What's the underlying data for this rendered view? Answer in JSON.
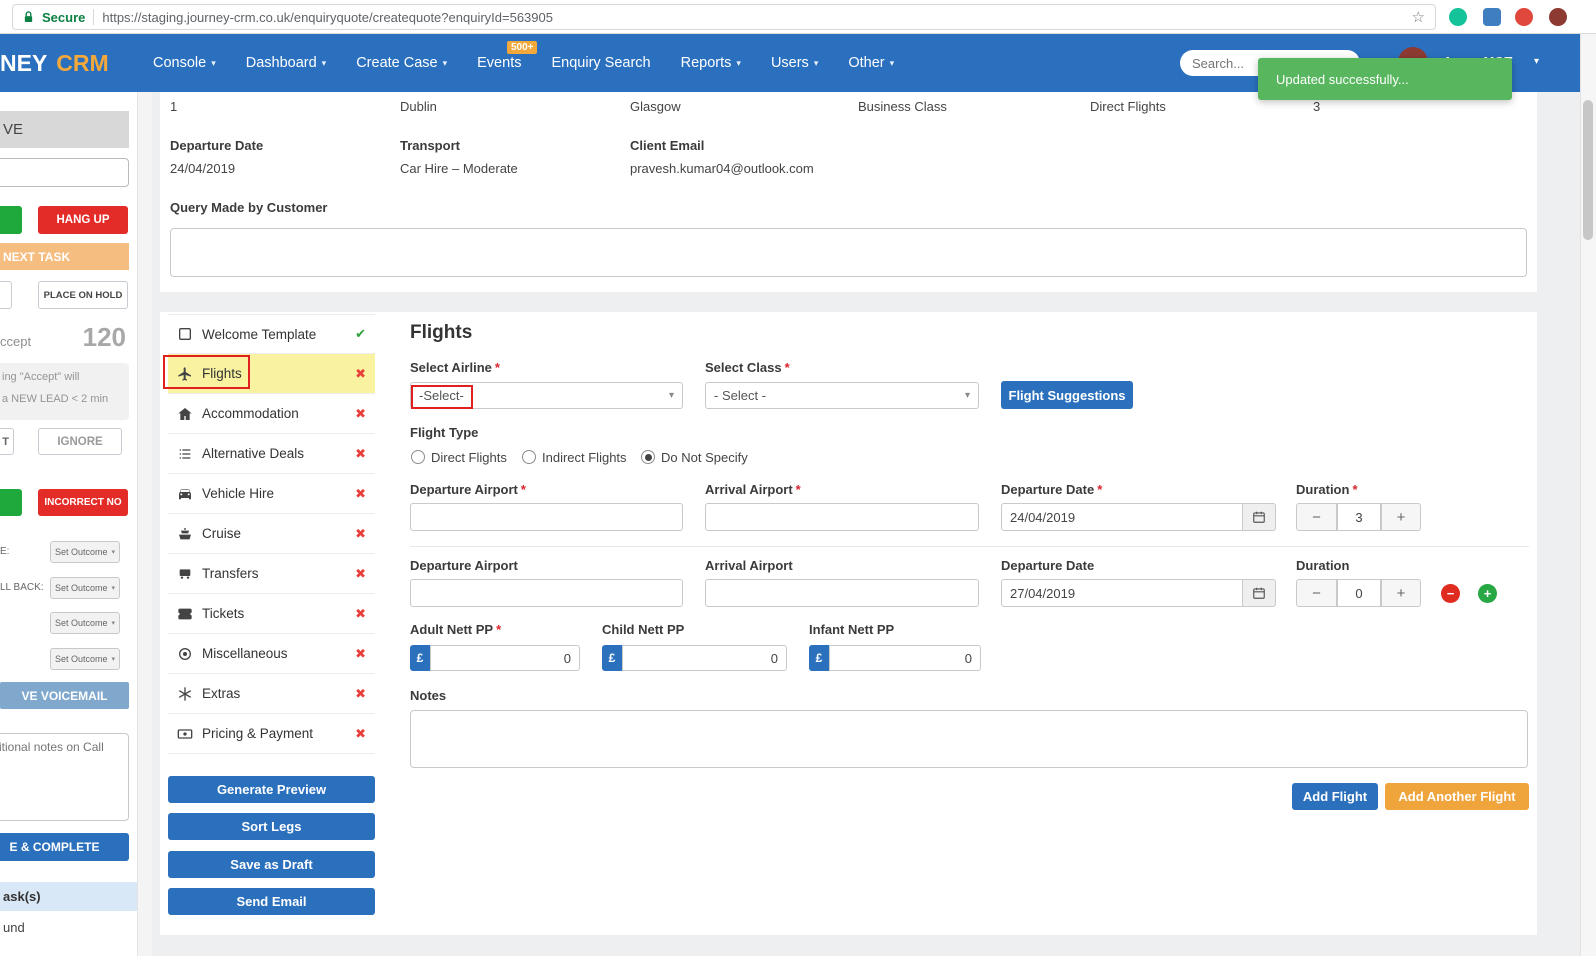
{
  "browser": {
    "secure_label": "Secure",
    "url": "https://staging.journey-crm.co.uk/enquiryquote/createquote?enquiryId=563905"
  },
  "toast": {
    "message": "Updated successfully..."
  },
  "nav": {
    "brand_left": "NEY",
    "brand_right": "CRM",
    "menu": [
      {
        "label": "Console"
      },
      {
        "label": "Dashboard"
      },
      {
        "label": "Create Case"
      },
      {
        "label": "Events",
        "badge": "500+"
      },
      {
        "label": "Enquiry Search"
      },
      {
        "label": "Reports"
      },
      {
        "label": "Users"
      },
      {
        "label": "Other"
      }
    ],
    "search_placeholder": "Search...",
    "user_name": "Arnav MQT"
  },
  "left_panel": {
    "header_fragment": "VE",
    "hang_up_button": "HANG UP",
    "next_task_label": "NEXT TASK",
    "place_on_hold_button": "PLACE ON HOLD",
    "accept_fragment": "ccept",
    "accept_count": "120",
    "accept_note_line1": "ing \"Accept\" will",
    "accept_note_line2": "a NEW LEAD < 2 min",
    "accept_button_fragment": "T",
    "ignore_button": "IGNORE",
    "incorrect_no_button": "INCORRECT NO",
    "outcome_label_1": "E:",
    "outcome_label_2": "LL BACK:",
    "outcome_value": "Set Outcome",
    "voicemail_button": "VE VOICEMAIL",
    "notes_placeholder": "itional notes on Call",
    "complete_button": "E & COMPLETE",
    "tasks_fragment": "ask(s)",
    "found_fragment": "und"
  },
  "enquiry": {
    "row_values": [
      "1",
      "Dublin",
      "Glasgow",
      "Business Class",
      "Direct Flights",
      "3"
    ],
    "fields": [
      {
        "label": "Departure Date",
        "value": "24/04/2019"
      },
      {
        "label": "Transport",
        "value": "Car Hire – Moderate"
      },
      {
        "label": "Client Email",
        "value": "pravesh.kumar04@outlook.com"
      }
    ],
    "query_label": "Query Made by Customer"
  },
  "quote_tabs": {
    "items": [
      {
        "label": "Welcome Template",
        "status": "done"
      },
      {
        "label": "Flights",
        "status": "pending"
      },
      {
        "label": "Accommodation",
        "status": "pending"
      },
      {
        "label": "Alternative Deals",
        "status": "pending"
      },
      {
        "label": "Vehicle Hire",
        "status": "pending"
      },
      {
        "label": "Cruise",
        "status": "pending"
      },
      {
        "label": "Transfers",
        "status": "pending"
      },
      {
        "label": "Tickets",
        "status": "pending"
      },
      {
        "label": "Miscellaneous",
        "status": "pending"
      },
      {
        "label": "Extras",
        "status": "pending"
      },
      {
        "label": "Pricing & Payment",
        "status": "pending"
      }
    ],
    "actions": [
      "Generate Preview",
      "Sort Legs",
      "Save as Draft",
      "Send Email"
    ]
  },
  "flights": {
    "title": "Flights",
    "required_marker": "*",
    "airline": {
      "label": "Select Airline",
      "value": "-Select-"
    },
    "cabin": {
      "label": "Select Class",
      "value": "- Select -"
    },
    "suggestions_button": "Flight Suggestions",
    "type_label": "Flight Type",
    "type_options": [
      "Direct Flights",
      "Indirect Flights",
      "Do Not Specify"
    ],
    "selected_type": "Do Not Specify",
    "leg_labels": {
      "departure": "Departure Airport",
      "arrival": "Arrival Airport",
      "date": "Departure Date",
      "duration": "Duration"
    },
    "legs": [
      {
        "date": "24/04/2019",
        "duration": "3"
      },
      {
        "date": "27/04/2019",
        "duration": "0"
      }
    ],
    "nett": [
      {
        "label": "Adult Nett PP",
        "currency": "£",
        "value": "0"
      },
      {
        "label": "Child Nett PP",
        "currency": "£",
        "value": "0"
      },
      {
        "label": "Infant Nett PP",
        "currency": "£",
        "value": "0"
      }
    ],
    "notes_label": "Notes",
    "add_flight_button": "Add Flight",
    "add_another_flight_button": "Add Another Flight"
  }
}
